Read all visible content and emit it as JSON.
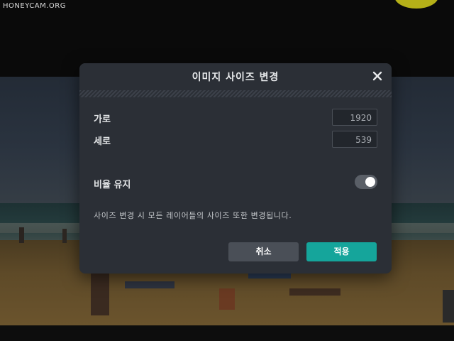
{
  "watermark": "HONEYCAM.ORG",
  "dialog": {
    "title": "이미지 사이즈 변경",
    "width_label": "가로",
    "width_value": "1920",
    "height_label": "세로",
    "height_value": "539",
    "keep_ratio_label": "비율 유지",
    "keep_ratio_on": true,
    "note": "사이즈 변경 시 모든 레이어들의 사이즈 또한 변경됩니다.",
    "cancel_label": "취소",
    "apply_label": "적용"
  },
  "colors": {
    "dialog_bg": "#2b2f36",
    "accent": "#15a59b",
    "cancel": "#4a4f57"
  },
  "icons": {
    "close": "close-icon"
  }
}
